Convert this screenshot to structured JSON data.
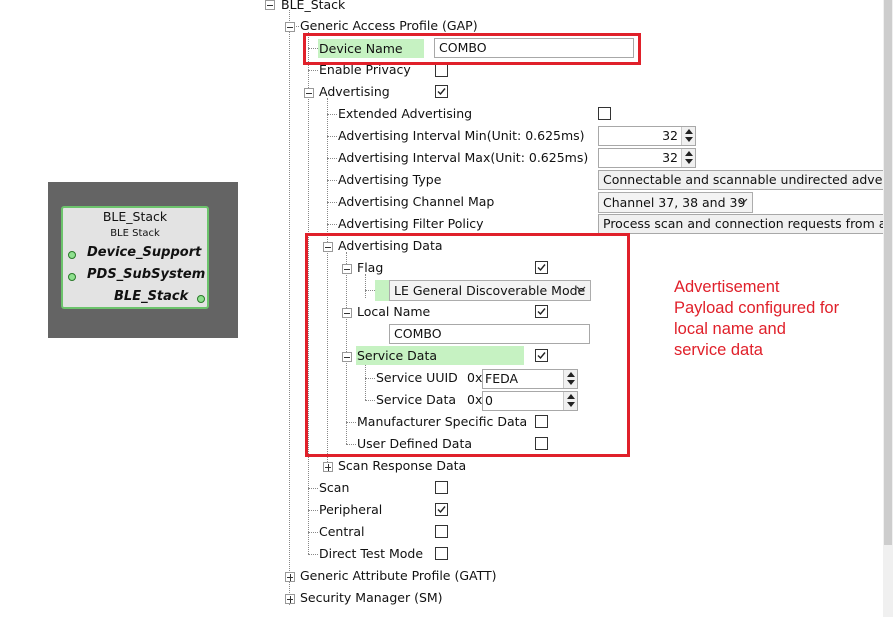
{
  "card": {
    "title": "BLE_Stack",
    "subtitle": "BLE Stack",
    "ports": [
      "Device_Support",
      "PDS_SubSystem",
      "BLE_Stack"
    ]
  },
  "tree": {
    "root": "BLE_Stack",
    "gap": "Generic Access Profile (GAP)",
    "device_name_label": "Device Name",
    "device_name_value": "COMBO",
    "enable_privacy": "Enable Privacy",
    "advertising": "Advertising",
    "extended_advertising": "Extended Advertising",
    "adv_interval_min": "Advertising Interval Min(Unit: 0.625ms)",
    "adv_interval_min_value": "32",
    "adv_interval_max": "Advertising Interval Max(Unit: 0.625ms)",
    "adv_interval_max_value": "32",
    "adv_type": "Advertising Type",
    "adv_type_value": "Connectable and scannable undirected advertisin",
    "adv_channel_map": "Advertising Channel Map",
    "adv_channel_map_value": "Channel 37, 38 and 39",
    "adv_filter_policy": "Advertising Filter Policy",
    "adv_filter_policy_value": "Process scan and connection requests from all de",
    "adv_data": "Advertising Data",
    "flag": "Flag",
    "flag_value": "LE General Discoverable Mode",
    "local_name": "Local Name",
    "local_name_value": "COMBO",
    "service_data": "Service Data",
    "service_uuid": "Service UUID",
    "hex_prefix": "0x",
    "service_uuid_value": "FEDA",
    "service_data_field": "Service Data",
    "service_data_value": "0",
    "manufacturer_data": "Manufacturer Specific Data",
    "user_defined_data": "User Defined Data",
    "scan_response_data": "Scan Response Data",
    "scan": "Scan",
    "peripheral": "Peripheral",
    "central": "Central",
    "direct_test_mode": "Direct Test Mode",
    "gatt": "Generic Attribute Profile (GATT)",
    "sm": "Security Manager (SM)"
  },
  "checkboxes": {
    "enable_privacy": false,
    "advertising": true,
    "extended_advertising": false,
    "flag": true,
    "local_name": true,
    "service_data": true,
    "manufacturer_data": false,
    "user_defined_data": false,
    "scan": false,
    "peripheral": true,
    "central": false,
    "direct_test_mode": false
  },
  "annotation": {
    "lines": [
      "Advertisement",
      "Payload configured for",
      "local name and",
      "service data"
    ]
  },
  "colors": {
    "highlight": "#c6f2c2",
    "annotation_red": "#e0202a",
    "card_border": "#6cc36c"
  }
}
